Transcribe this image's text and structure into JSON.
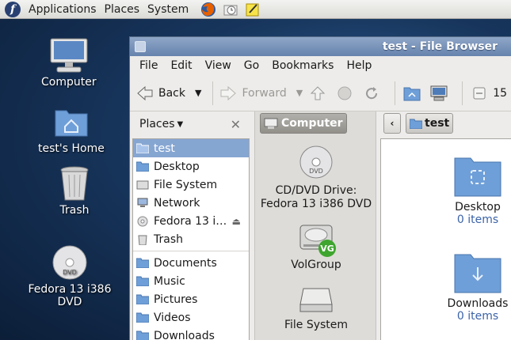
{
  "panel": {
    "menus": [
      "Applications",
      "Places",
      "System"
    ]
  },
  "desktop": {
    "icons": [
      {
        "label": "Computer"
      },
      {
        "label": "test's Home"
      },
      {
        "label": "Trash"
      },
      {
        "label": "Fedora 13 i386 DVD"
      }
    ]
  },
  "window": {
    "title": "test - File Browser",
    "menus": [
      "File",
      "Edit",
      "View",
      "Go",
      "Bookmarks",
      "Help"
    ],
    "toolbar": {
      "back": "Back",
      "forward": "Forward",
      "zoom": "15"
    },
    "sidebar": {
      "header": "Places",
      "items": [
        {
          "label": "test",
          "icon": "home-folder-icon",
          "selected": true
        },
        {
          "label": "Desktop",
          "icon": "desktop-folder-icon"
        },
        {
          "label": "File System",
          "icon": "drive-icon"
        },
        {
          "label": "Network",
          "icon": "network-icon"
        },
        {
          "label": "Fedora 13 i…",
          "icon": "dvd-icon"
        },
        {
          "label": "Trash",
          "icon": "trash-icon"
        }
      ],
      "bookmarks": [
        {
          "label": "Documents"
        },
        {
          "label": "Music"
        },
        {
          "label": "Pictures"
        },
        {
          "label": "Videos"
        },
        {
          "label": "Downloads"
        }
      ]
    },
    "computer_pane": {
      "button": "Computer",
      "volumes": [
        {
          "label": "CD/DVD Drive:\nFedora 13 i386 DVD"
        },
        {
          "label": "VolGroup",
          "badge": "VG"
        },
        {
          "label": "File System"
        }
      ]
    },
    "location": {
      "crumb": "test"
    },
    "files": [
      {
        "name": "Desktop",
        "sub": "0 items"
      },
      {
        "name": "Downloads",
        "sub": "0 items"
      }
    ]
  }
}
